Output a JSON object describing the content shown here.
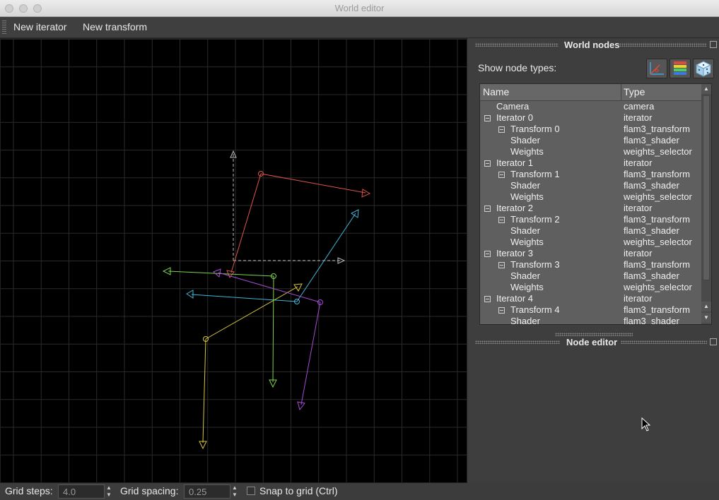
{
  "window": {
    "title": "World editor"
  },
  "toolbar": {
    "new_iterator": "New iterator",
    "new_transform": "New transform"
  },
  "status": {
    "grid_steps_label": "Grid steps:",
    "grid_steps_value": "4.0",
    "grid_spacing_label": "Grid spacing:",
    "grid_spacing_value": "0.25",
    "snap_label": "Snap to grid (Ctrl)"
  },
  "world_nodes": {
    "title": "World nodes",
    "show_node_types": "Show node types:",
    "columns": {
      "name": "Name",
      "type": "Type"
    },
    "rows": [
      {
        "name": "Camera",
        "type": "camera",
        "level": 0,
        "expander": false
      },
      {
        "name": "Iterator 0",
        "type": "iterator",
        "level": 0,
        "expander": true
      },
      {
        "name": "Transform 0",
        "type": "flam3_transform",
        "level": 1,
        "expander": true
      },
      {
        "name": "Shader",
        "type": "flam3_shader",
        "level": 1,
        "expander": false
      },
      {
        "name": "Weights",
        "type": "weights_selector",
        "level": 1,
        "expander": false
      },
      {
        "name": "Iterator 1",
        "type": "iterator",
        "level": 0,
        "expander": true
      },
      {
        "name": "Transform 1",
        "type": "flam3_transform",
        "level": 1,
        "expander": true
      },
      {
        "name": "Shader",
        "type": "flam3_shader",
        "level": 1,
        "expander": false
      },
      {
        "name": "Weights",
        "type": "weights_selector",
        "level": 1,
        "expander": false
      },
      {
        "name": "Iterator 2",
        "type": "iterator",
        "level": 0,
        "expander": true
      },
      {
        "name": "Transform 2",
        "type": "flam3_transform",
        "level": 1,
        "expander": true
      },
      {
        "name": "Shader",
        "type": "flam3_shader",
        "level": 1,
        "expander": false
      },
      {
        "name": "Weights",
        "type": "weights_selector",
        "level": 1,
        "expander": false
      },
      {
        "name": "Iterator 3",
        "type": "iterator",
        "level": 0,
        "expander": true
      },
      {
        "name": "Transform 3",
        "type": "flam3_transform",
        "level": 1,
        "expander": true
      },
      {
        "name": "Shader",
        "type": "flam3_shader",
        "level": 1,
        "expander": false
      },
      {
        "name": "Weights",
        "type": "weights_selector",
        "level": 1,
        "expander": false
      },
      {
        "name": "Iterator 4",
        "type": "iterator",
        "level": 0,
        "expander": true
      },
      {
        "name": "Transform 4",
        "type": "flam3_transform",
        "level": 1,
        "expander": true
      },
      {
        "name": "Shader",
        "type": "flam3_shader",
        "level": 1,
        "expander": false
      }
    ]
  },
  "node_editor": {
    "title": "Node editor"
  },
  "colors": {
    "transform_0": "#e0554a",
    "transform_1": "#3fb7d8",
    "transform_2": "#d6c83a",
    "transform_3": "#7bd44a",
    "transform_4": "#a64bd6",
    "axes": "#bbbbbb",
    "grid": "#2a2a2a"
  }
}
